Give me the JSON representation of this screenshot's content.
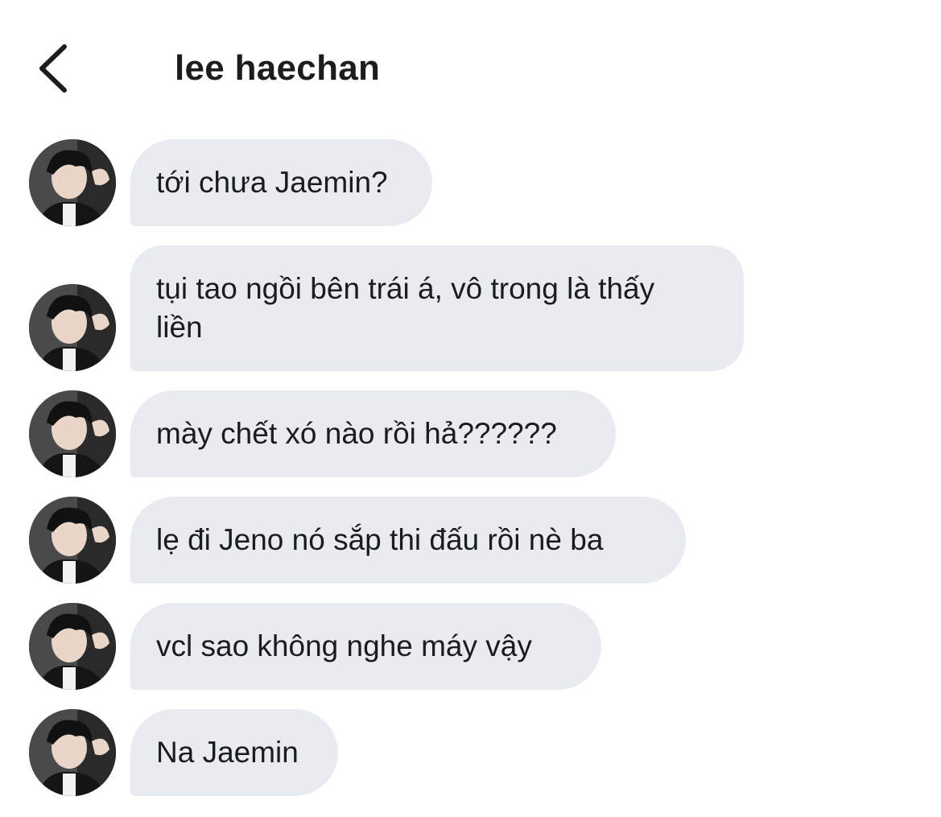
{
  "header": {
    "title": "lee haechan",
    "back_icon": "chevron-left-icon"
  },
  "colors": {
    "bubble_bg": "#e8ebef",
    "text": "#1c1c1e",
    "background": "#ffffff"
  },
  "messages": [
    {
      "text": "tới chưa Jaemin?"
    },
    {
      "text": "tụi tao ngồi bên trái á, vô trong là thấy liền"
    },
    {
      "text": "mày chết xó nào rồi hả??????"
    },
    {
      "text": "lẹ đi Jeno nó sắp thi đấu rồi nè ba"
    },
    {
      "text": "vcl sao không nghe máy vậy"
    },
    {
      "text": "Na Jaemin"
    }
  ]
}
